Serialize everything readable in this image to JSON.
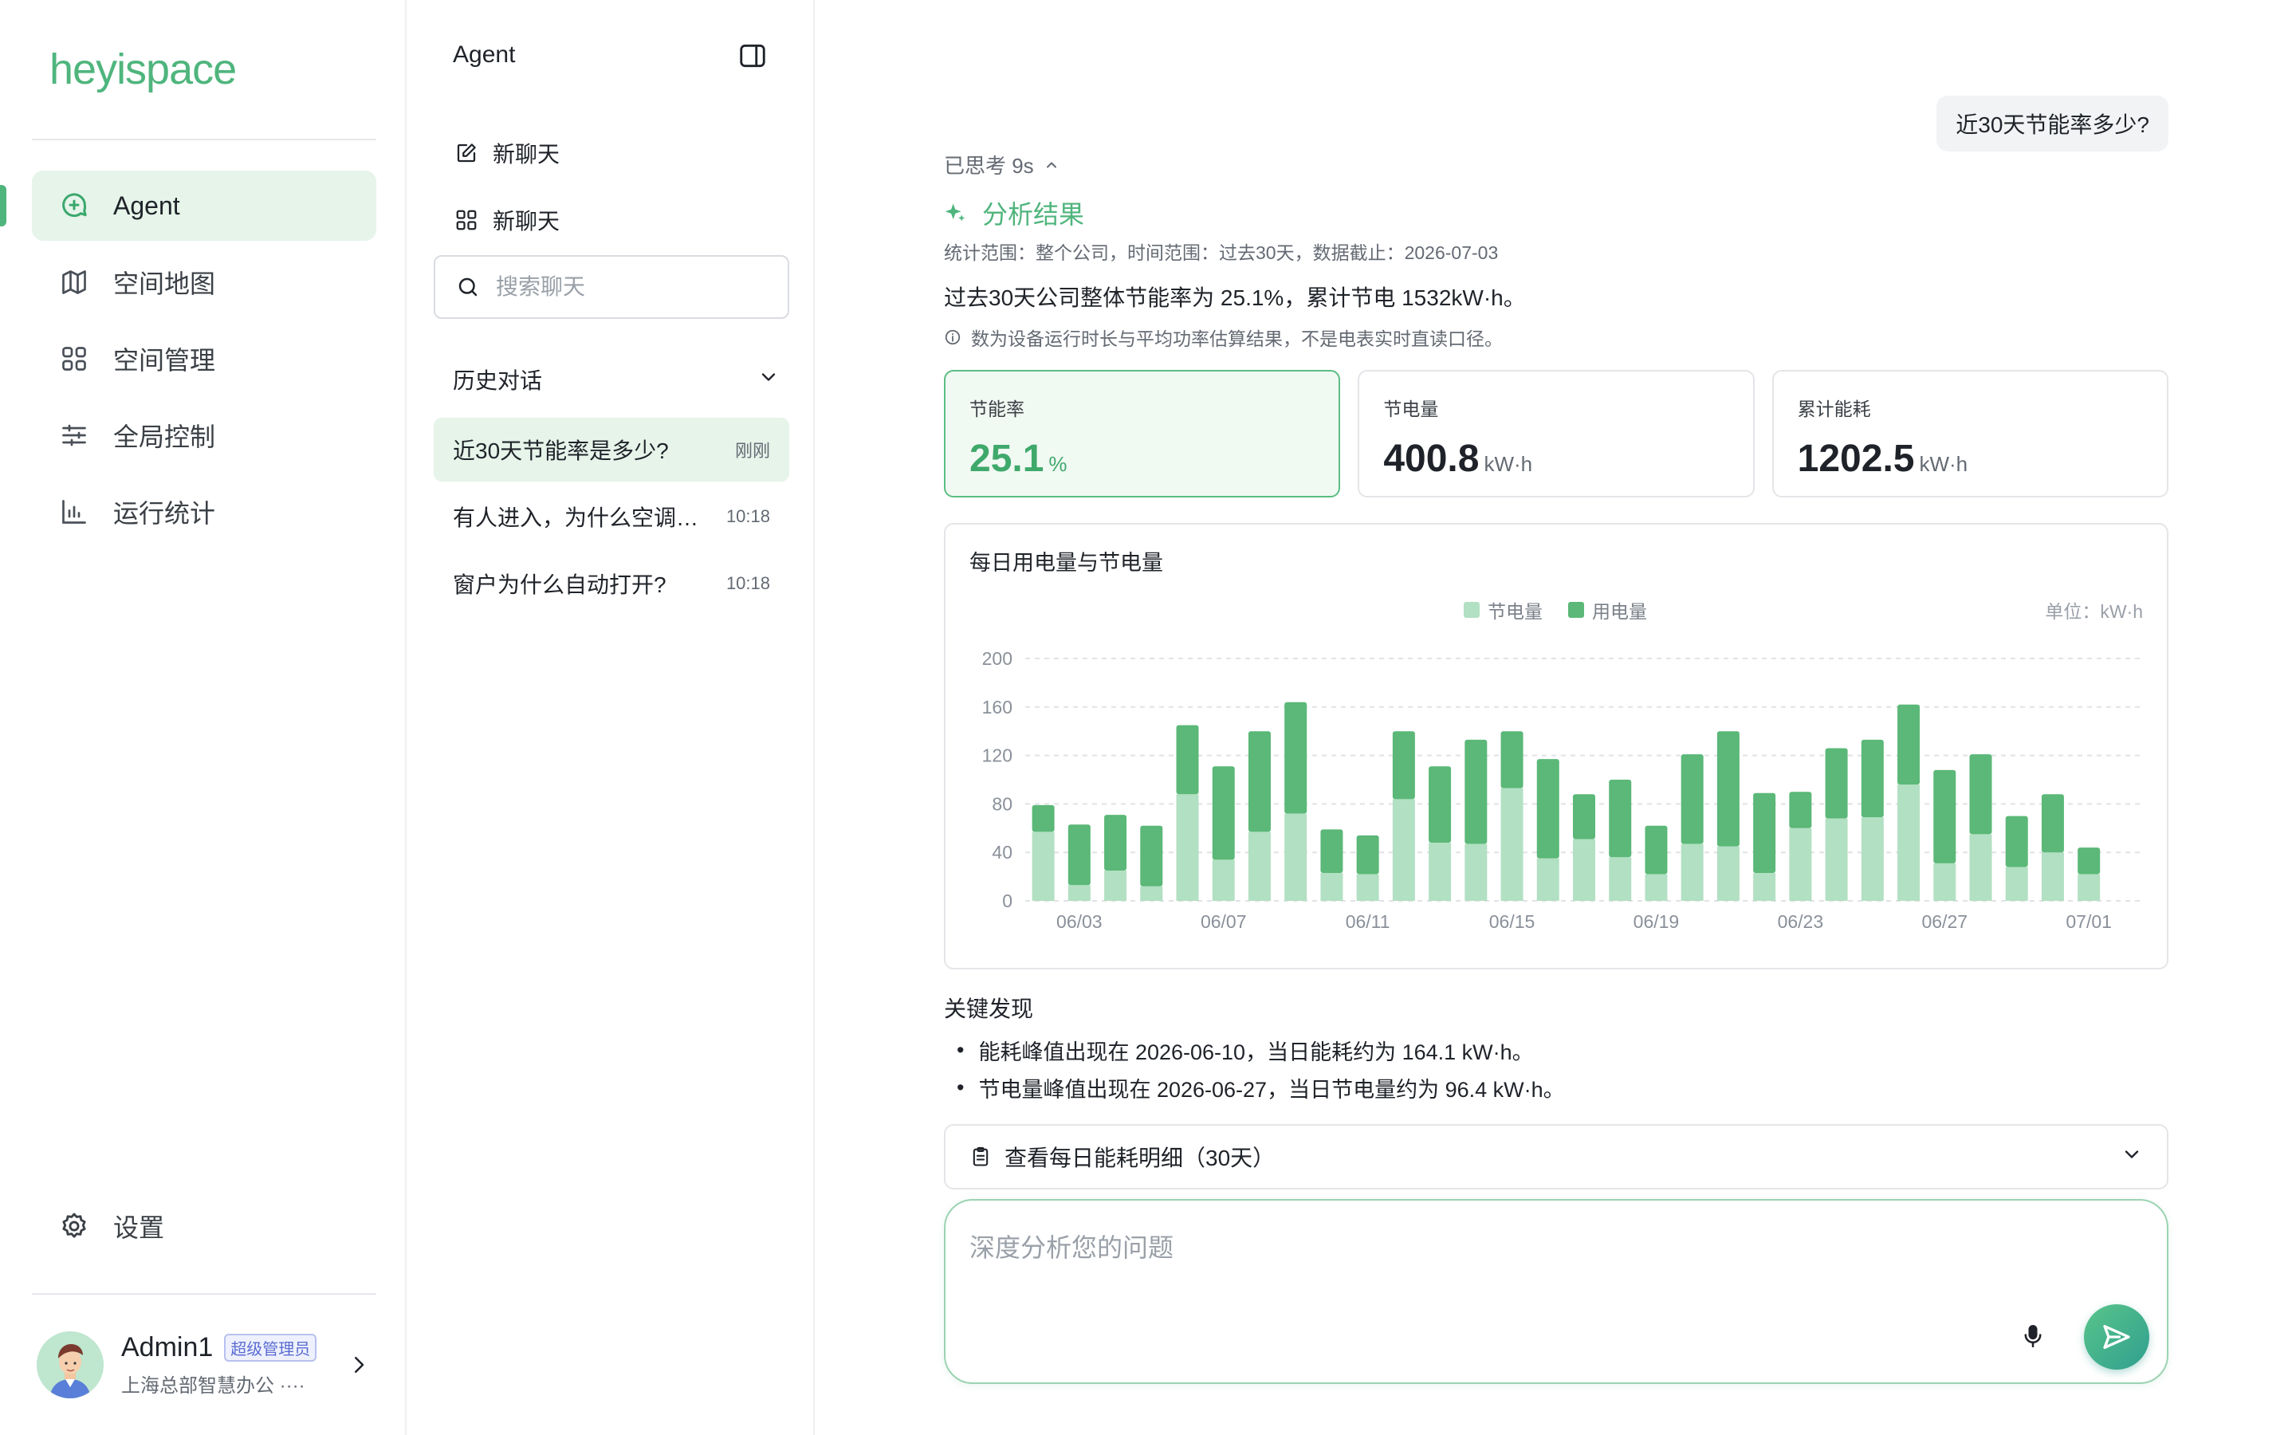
{
  "brand": {
    "logo_text": "heyispace"
  },
  "sidebar": {
    "items": [
      {
        "label": "Agent",
        "icon": "agent-icon",
        "active": true
      },
      {
        "label": "空间地图",
        "icon": "map-icon",
        "active": false
      },
      {
        "label": "空间管理",
        "icon": "grid-icon",
        "active": false
      },
      {
        "label": "全局控制",
        "icon": "sliders-icon",
        "active": false
      },
      {
        "label": "运行统计",
        "icon": "bar-chart-icon",
        "active": false
      }
    ],
    "settings_label": "设置",
    "user": {
      "name": "Admin1",
      "role": "超级管理员",
      "org": "上海总部智慧办公 ····"
    }
  },
  "chatlist": {
    "title": "Agent",
    "new_chat_1": "新聊天",
    "new_chat_2": "新聊天",
    "search_placeholder": "搜索聊天",
    "history_title": "历史对话",
    "history": [
      {
        "text": "近30天节能率是多少?",
        "time": "刚刚",
        "active": true
      },
      {
        "text": "有人进入，为什么空调…",
        "time": "10:18",
        "active": false
      },
      {
        "text": "窗户为什么自动打开?",
        "time": "10:18",
        "active": false
      }
    ]
  },
  "conversation": {
    "user_question": "近30天节能率多少?",
    "thought_label": "已思考 9s",
    "result_title": "分析结果",
    "meta": "统计范围：整个公司，时间范围：过去30天，数据截止：2026-07-03",
    "summary": "过去30天公司整体节能率为 25.1%，累计节电 1532kW·h。",
    "note": "数为设备运行时长与平均功率估算结果，不是电表实时直读口径。",
    "stats": [
      {
        "label": "节能率",
        "value": "25.1",
        "unit": "%",
        "active": true
      },
      {
        "label": "节电量",
        "value": "400.8",
        "unit": "kW·h",
        "active": false
      },
      {
        "label": "累计能耗",
        "value": "1202.5",
        "unit": "kW·h",
        "active": false
      }
    ],
    "findings_title": "关键发现",
    "findings": [
      "能耗峰值出现在 2026-06-10，当日能耗约为 164.1 kW·h。",
      "节电量峰值出现在 2026-06-27，当日节电量约为 96.4 kW·h。"
    ],
    "detail_label": "查看每日能耗明细（30天）",
    "composer_placeholder": "深度分析您的问题"
  },
  "colors": {
    "accent": "#4fb57d",
    "saved_series": "#b2e0c2",
    "usage_series": "#5bb878",
    "active_bg": "#e6f4ea"
  },
  "chart_data": {
    "type": "bar",
    "stacked": true,
    "title": "每日用电量与节电量",
    "unit_label": "单位：kW·h",
    "categories": [
      "06/02",
      "06/03",
      "06/04",
      "06/05",
      "06/06",
      "06/07",
      "06/08",
      "06/09",
      "06/10",
      "06/11",
      "06/12",
      "06/13",
      "06/14",
      "06/15",
      "06/16",
      "06/17",
      "06/18",
      "06/19",
      "06/20",
      "06/21",
      "06/22",
      "06/23",
      "06/24",
      "06/25",
      "06/26",
      "06/27",
      "06/28",
      "06/29",
      "06/30",
      "07/01",
      "07/02"
    ],
    "tick_labels": [
      "06/03",
      "06/07",
      "06/11",
      "06/15",
      "06/19",
      "06/23",
      "06/27",
      "07/01"
    ],
    "series": [
      {
        "name": "节电量",
        "values": [
          57,
          13,
          25,
          12,
          88,
          34,
          57,
          72,
          23,
          22,
          84,
          48,
          47,
          93,
          35,
          51,
          36,
          22,
          47,
          45,
          23,
          60,
          68,
          69,
          96,
          31,
          55,
          28,
          40,
          22,
          0
        ]
      },
      {
        "name": "用电量",
        "values": [
          22,
          50,
          46,
          50,
          57,
          77,
          83,
          92,
          36,
          32,
          56,
          63,
          86,
          47,
          82,
          37,
          64,
          40,
          74,
          95,
          66,
          30,
          58,
          64,
          66,
          77,
          66,
          42,
          48,
          22,
          0
        ]
      }
    ],
    "ylim": [
      0,
      200
    ],
    "yticks": [
      0,
      40,
      80,
      120,
      160,
      200
    ],
    "grid": true,
    "legend": "top-center"
  }
}
